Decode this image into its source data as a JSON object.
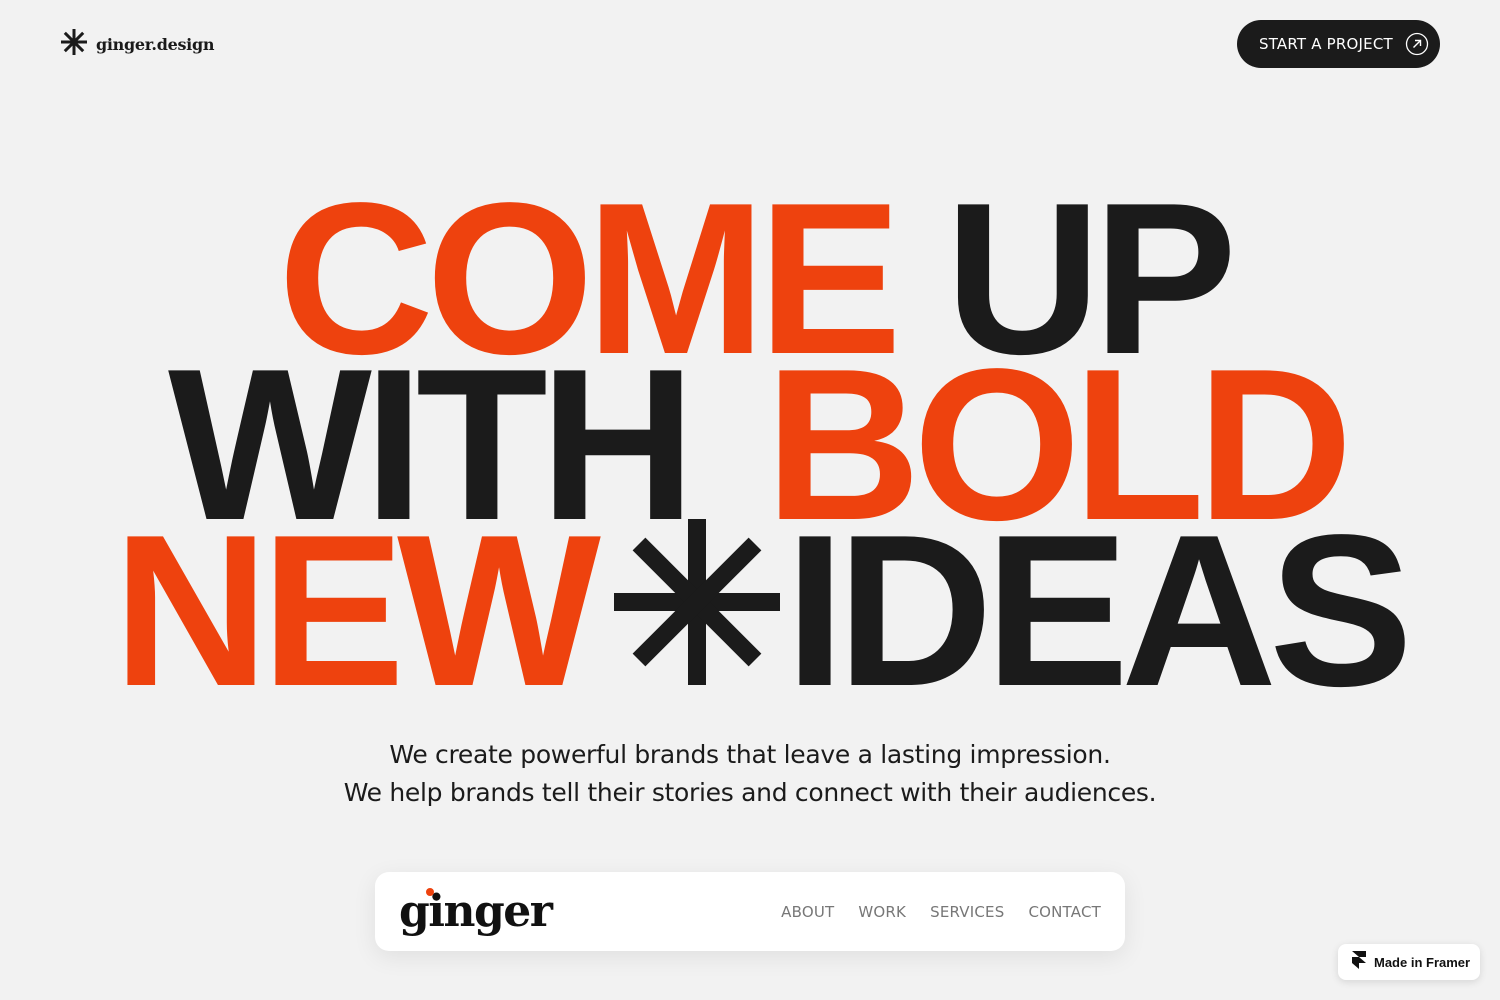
{
  "header": {
    "logo_text": "ginger.design",
    "logo_icon": "asterisk-icon",
    "cta_label": "START A PROJECT",
    "cta_icon": "arrow-up-right-circle-icon"
  },
  "headline": {
    "line1": [
      {
        "text": "COME",
        "color": "#ee420e"
      },
      {
        "text": "UP",
        "color": "#1b1b1b"
      }
    ],
    "line2": [
      {
        "text": "WITH",
        "color": "#1b1b1b"
      },
      {
        "text": "BOLD",
        "color": "#ee420e"
      }
    ],
    "line3": [
      {
        "text": "NEW",
        "color": "#ee420e"
      },
      {
        "text": "IDEAS",
        "color": "#1b1b1b"
      }
    ],
    "separator_icon": "asterisk-icon"
  },
  "subtitle": {
    "line1": "We create powerful brands that leave a lasting impression.",
    "line2": "We help brands tell their stories and connect with their audiences."
  },
  "nav": {
    "brand": "ginger",
    "links": [
      "ABOUT",
      "WORK",
      "SERVICES",
      "CONTACT"
    ]
  },
  "framer_badge": {
    "label": "Made in Framer",
    "icon": "framer-icon"
  },
  "colors": {
    "accent": "#ee420e",
    "dark": "#1b1b1b",
    "background": "#f2f2f2"
  }
}
